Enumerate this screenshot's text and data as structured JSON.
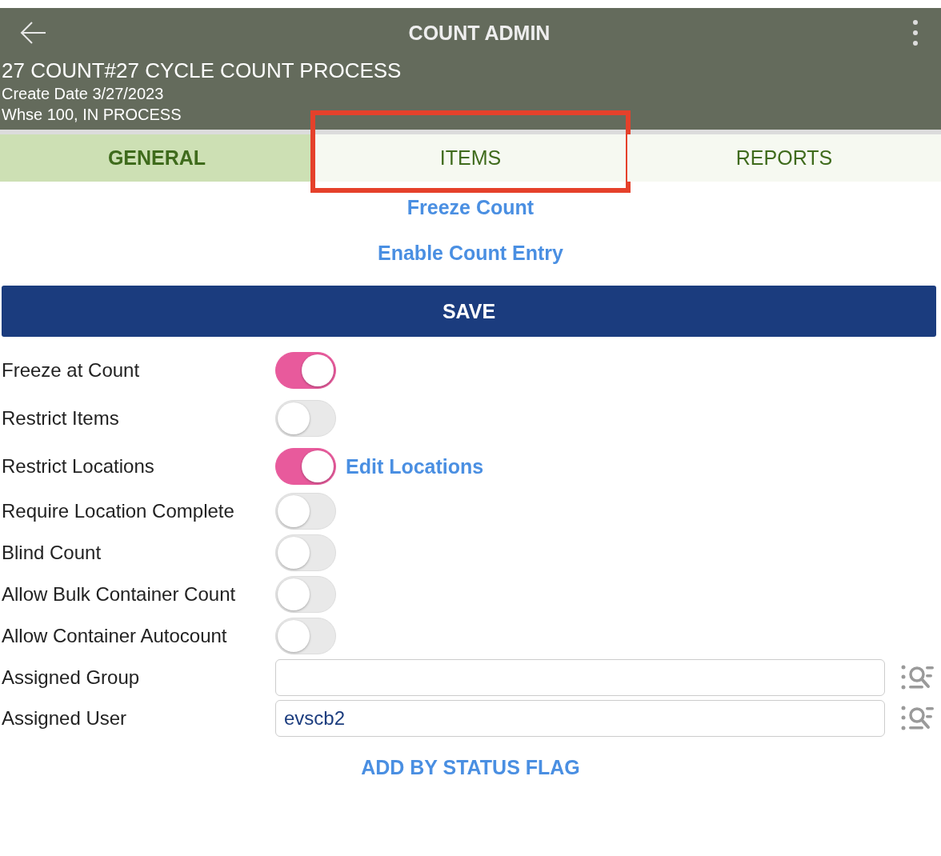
{
  "header": {
    "title": "COUNT ADMIN",
    "count_title": "27 COUNT#27 CYCLE COUNT PROCESS",
    "create_date": "Create Date 3/27/2023",
    "status": "Whse 100, IN PROCESS"
  },
  "tabs": [
    {
      "label": "GENERAL",
      "selected": true,
      "highlighted": false
    },
    {
      "label": "ITEMS",
      "selected": false,
      "highlighted": true
    },
    {
      "label": "REPORTS",
      "selected": false,
      "highlighted": false
    }
  ],
  "actions": [
    "Freeze Count",
    "Enable Count Entry"
  ],
  "save_button": "SAVE",
  "fields": [
    {
      "kind": "toggle",
      "label": "Freeze at Count",
      "on": true
    },
    {
      "kind": "toggle",
      "label": "Restrict Items",
      "on": false
    },
    {
      "kind": "toggle",
      "label": "Restrict Locations",
      "on": true,
      "link": "Edit Locations"
    },
    {
      "kind": "toggle",
      "label": "Require Location Complete",
      "on": false
    },
    {
      "kind": "toggle",
      "label": "Blind Count",
      "on": false
    },
    {
      "kind": "toggle",
      "label": "Allow Bulk Container Count",
      "on": false
    },
    {
      "kind": "toggle",
      "label": "Allow Container Autocount",
      "on": false
    },
    {
      "kind": "lookup",
      "label": "Assigned Group"
    },
    {
      "kind": "lookup",
      "label": "Assigned User",
      "value": "evscb2"
    }
  ],
  "footer_link": "ADD BY STATUS FLAG"
}
